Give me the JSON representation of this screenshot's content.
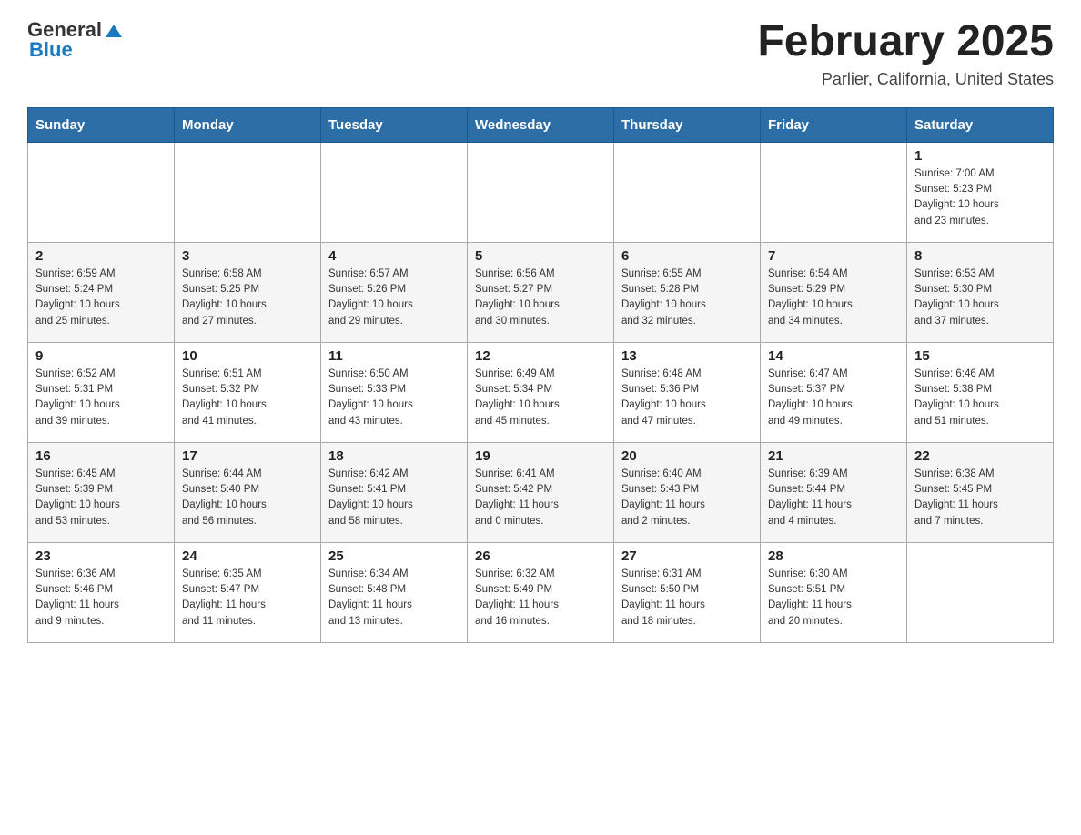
{
  "header": {
    "logo_general": "General",
    "logo_blue": "Blue",
    "month_title": "February 2025",
    "location": "Parlier, California, United States"
  },
  "days_of_week": [
    "Sunday",
    "Monday",
    "Tuesday",
    "Wednesday",
    "Thursday",
    "Friday",
    "Saturday"
  ],
  "weeks": [
    [
      {
        "day": "",
        "info": ""
      },
      {
        "day": "",
        "info": ""
      },
      {
        "day": "",
        "info": ""
      },
      {
        "day": "",
        "info": ""
      },
      {
        "day": "",
        "info": ""
      },
      {
        "day": "",
        "info": ""
      },
      {
        "day": "1",
        "info": "Sunrise: 7:00 AM\nSunset: 5:23 PM\nDaylight: 10 hours\nand 23 minutes."
      }
    ],
    [
      {
        "day": "2",
        "info": "Sunrise: 6:59 AM\nSunset: 5:24 PM\nDaylight: 10 hours\nand 25 minutes."
      },
      {
        "day": "3",
        "info": "Sunrise: 6:58 AM\nSunset: 5:25 PM\nDaylight: 10 hours\nand 27 minutes."
      },
      {
        "day": "4",
        "info": "Sunrise: 6:57 AM\nSunset: 5:26 PM\nDaylight: 10 hours\nand 29 minutes."
      },
      {
        "day": "5",
        "info": "Sunrise: 6:56 AM\nSunset: 5:27 PM\nDaylight: 10 hours\nand 30 minutes."
      },
      {
        "day": "6",
        "info": "Sunrise: 6:55 AM\nSunset: 5:28 PM\nDaylight: 10 hours\nand 32 minutes."
      },
      {
        "day": "7",
        "info": "Sunrise: 6:54 AM\nSunset: 5:29 PM\nDaylight: 10 hours\nand 34 minutes."
      },
      {
        "day": "8",
        "info": "Sunrise: 6:53 AM\nSunset: 5:30 PM\nDaylight: 10 hours\nand 37 minutes."
      }
    ],
    [
      {
        "day": "9",
        "info": "Sunrise: 6:52 AM\nSunset: 5:31 PM\nDaylight: 10 hours\nand 39 minutes."
      },
      {
        "day": "10",
        "info": "Sunrise: 6:51 AM\nSunset: 5:32 PM\nDaylight: 10 hours\nand 41 minutes."
      },
      {
        "day": "11",
        "info": "Sunrise: 6:50 AM\nSunset: 5:33 PM\nDaylight: 10 hours\nand 43 minutes."
      },
      {
        "day": "12",
        "info": "Sunrise: 6:49 AM\nSunset: 5:34 PM\nDaylight: 10 hours\nand 45 minutes."
      },
      {
        "day": "13",
        "info": "Sunrise: 6:48 AM\nSunset: 5:36 PM\nDaylight: 10 hours\nand 47 minutes."
      },
      {
        "day": "14",
        "info": "Sunrise: 6:47 AM\nSunset: 5:37 PM\nDaylight: 10 hours\nand 49 minutes."
      },
      {
        "day": "15",
        "info": "Sunrise: 6:46 AM\nSunset: 5:38 PM\nDaylight: 10 hours\nand 51 minutes."
      }
    ],
    [
      {
        "day": "16",
        "info": "Sunrise: 6:45 AM\nSunset: 5:39 PM\nDaylight: 10 hours\nand 53 minutes."
      },
      {
        "day": "17",
        "info": "Sunrise: 6:44 AM\nSunset: 5:40 PM\nDaylight: 10 hours\nand 56 minutes."
      },
      {
        "day": "18",
        "info": "Sunrise: 6:42 AM\nSunset: 5:41 PM\nDaylight: 10 hours\nand 58 minutes."
      },
      {
        "day": "19",
        "info": "Sunrise: 6:41 AM\nSunset: 5:42 PM\nDaylight: 11 hours\nand 0 minutes."
      },
      {
        "day": "20",
        "info": "Sunrise: 6:40 AM\nSunset: 5:43 PM\nDaylight: 11 hours\nand 2 minutes."
      },
      {
        "day": "21",
        "info": "Sunrise: 6:39 AM\nSunset: 5:44 PM\nDaylight: 11 hours\nand 4 minutes."
      },
      {
        "day": "22",
        "info": "Sunrise: 6:38 AM\nSunset: 5:45 PM\nDaylight: 11 hours\nand 7 minutes."
      }
    ],
    [
      {
        "day": "23",
        "info": "Sunrise: 6:36 AM\nSunset: 5:46 PM\nDaylight: 11 hours\nand 9 minutes."
      },
      {
        "day": "24",
        "info": "Sunrise: 6:35 AM\nSunset: 5:47 PM\nDaylight: 11 hours\nand 11 minutes."
      },
      {
        "day": "25",
        "info": "Sunrise: 6:34 AM\nSunset: 5:48 PM\nDaylight: 11 hours\nand 13 minutes."
      },
      {
        "day": "26",
        "info": "Sunrise: 6:32 AM\nSunset: 5:49 PM\nDaylight: 11 hours\nand 16 minutes."
      },
      {
        "day": "27",
        "info": "Sunrise: 6:31 AM\nSunset: 5:50 PM\nDaylight: 11 hours\nand 18 minutes."
      },
      {
        "day": "28",
        "info": "Sunrise: 6:30 AM\nSunset: 5:51 PM\nDaylight: 11 hours\nand 20 minutes."
      },
      {
        "day": "",
        "info": ""
      }
    ]
  ]
}
